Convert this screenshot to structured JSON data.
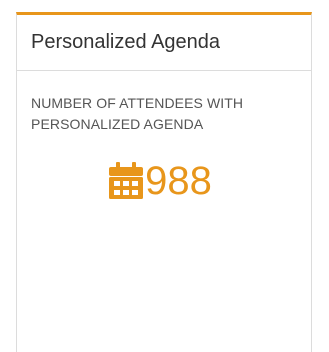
{
  "widget": {
    "title": "Personalized Agenda",
    "metric_label": "NUMBER OF ATTENDEES WITH PERSONALIZED AGENDA",
    "metric_value": "988",
    "icon": "calendar-icon",
    "accent_color": "#e8961b"
  }
}
